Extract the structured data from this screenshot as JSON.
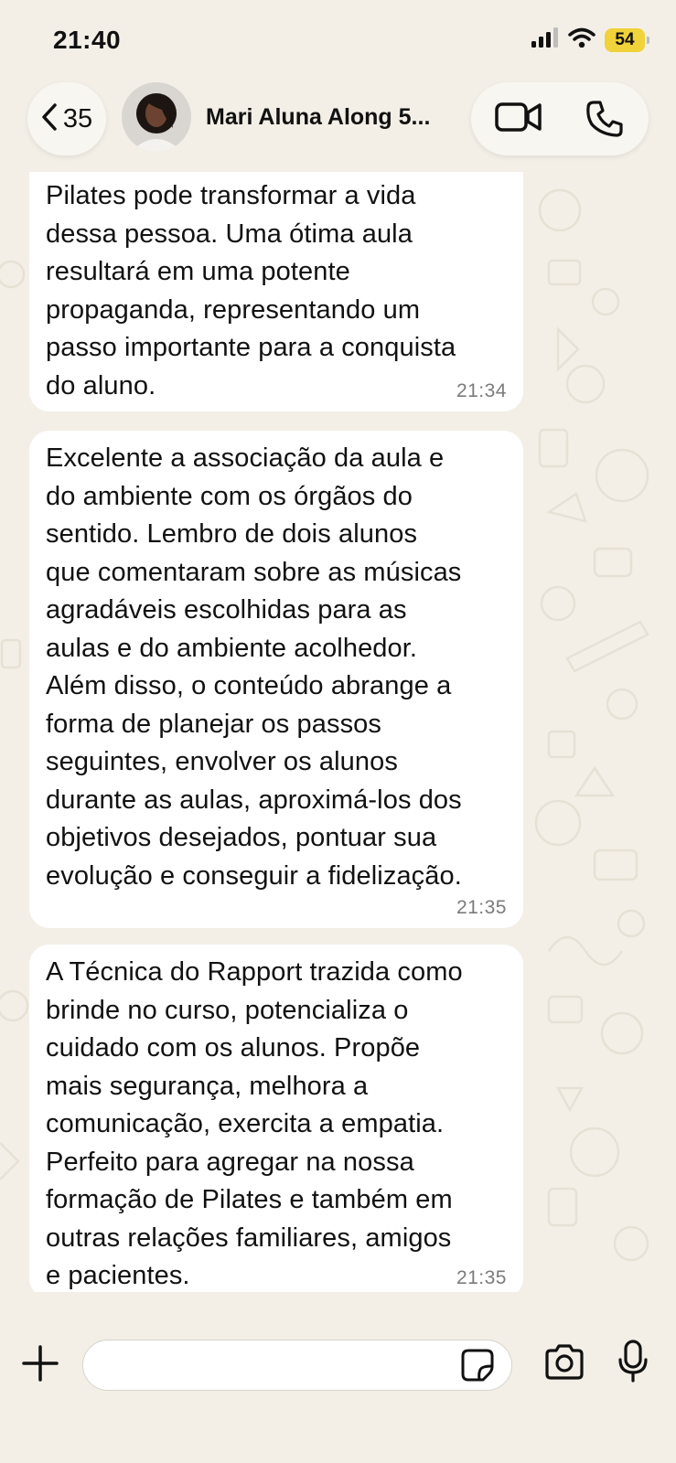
{
  "status_bar": {
    "time": "21:40",
    "battery_level": "54",
    "signal_icon": "cellular-signal-icon",
    "wifi_icon": "wifi-icon"
  },
  "header": {
    "back_count": "35",
    "contact_name": "Mari Aluna Along 5...",
    "video_call_icon": "video-camera-icon",
    "voice_call_icon": "phone-icon"
  },
  "messages": [
    {
      "text": "Pilates pode transformar a vida\ndessa pessoa. Uma ótima aula\nresultará em uma potente\npropaganda, representando um\npasso importante para a conquista\ndo aluno.",
      "time": "21:34"
    },
    {
      "text": "Excelente a  associação da aula e\ndo ambiente com os órgãos do\nsentido. Lembro de dois alunos\nque comentaram sobre as músicas\nagradáveis escolhidas para as\naulas e do ambiente acolhedor.\nAlém disso, o conteúdo abrange a\nforma de planejar os passos\nseguintes, envolver os alunos\ndurante as aulas, aproximá-los dos\nobjetivos desejados, pontuar sua\nevolução e conseguir a fidelização.",
      "time": "21:35"
    },
    {
      "text": "A Técnica do Rapport trazida como\nbrinde no curso, potencializa o\ncuidado com os alunos. Propõe\nmais segurança, melhora a\ncomunicação, exercita a empatia.\nPerfeito para agregar na nossa\nformação de Pilates e também em\noutras relações familiares, amigos\ne pacientes.",
      "time": "21:35"
    }
  ],
  "input_bar": {
    "message_value": "",
    "attach_icon": "plus-icon",
    "sticker_icon": "sticker-icon",
    "camera_icon": "camera-icon",
    "mic_icon": "microphone-icon"
  },
  "colors": {
    "background": "#f3efe7",
    "bubble": "#ffffff",
    "timestamp": "#7b7b7b",
    "battery": "#f0d23a"
  }
}
